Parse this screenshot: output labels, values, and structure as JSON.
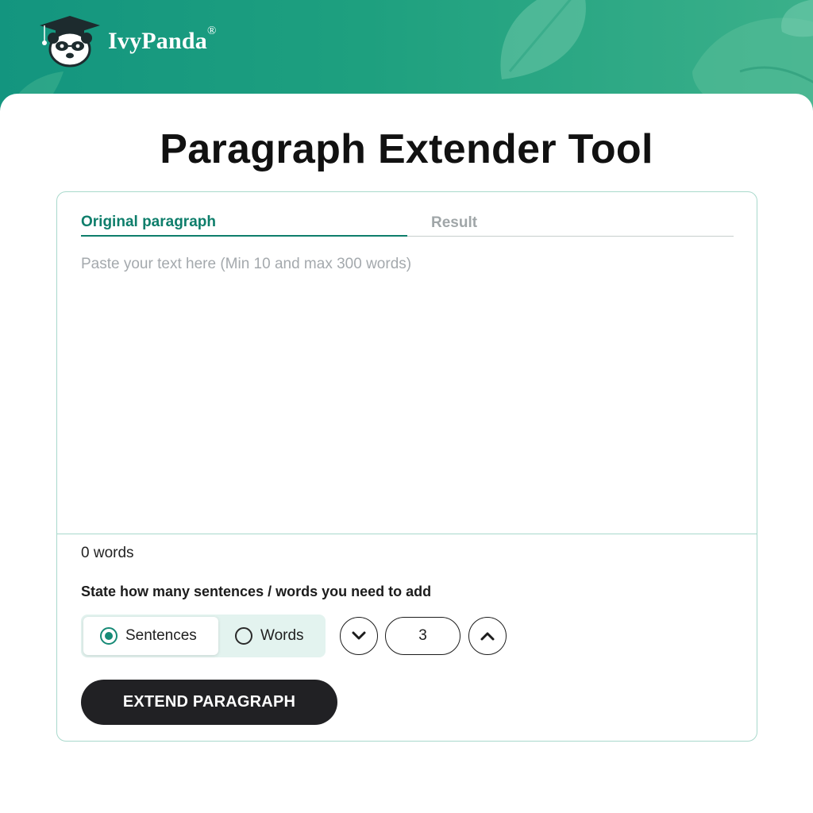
{
  "header": {
    "brand": "IvyPanda",
    "trademark": "®",
    "logo_icon": "panda-graduate-icon",
    "background_colors": [
      "#13957f",
      "#3bb08a"
    ]
  },
  "page_title": "Paragraph Extender Tool",
  "tabs": [
    {
      "label": "Original paragraph",
      "active": true
    },
    {
      "label": "Result",
      "active": false
    }
  ],
  "editor": {
    "placeholder": "Paste your text here (Min 10 and max 300 words)",
    "value": ""
  },
  "word_count": "0 words",
  "instructions": "State how many sentences / words you need to add",
  "mode": {
    "options": [
      {
        "label": "Sentences",
        "selected": true
      },
      {
        "label": "Words",
        "selected": false
      }
    ]
  },
  "stepper": {
    "value": "3",
    "decrease_icon": "chevron-down-icon",
    "increase_icon": "chevron-up-icon"
  },
  "extend_button": "EXTEND PARAGRAPH",
  "colors": {
    "accent": "#0e7e6b",
    "toggle_bg": "#e3f3ef",
    "button_dark": "#212124",
    "border": "#a9d9cc"
  }
}
